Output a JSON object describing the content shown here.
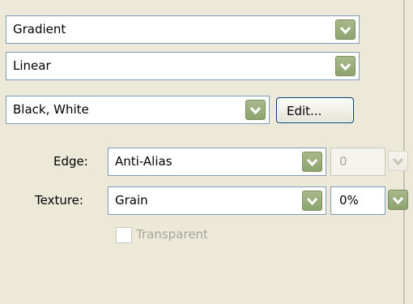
{
  "gradient_type_select": {
    "value": "Gradient"
  },
  "gradient_style_select": {
    "value": "Linear"
  },
  "color_select": {
    "value": "Black, White"
  },
  "edit_button": {
    "label": "Edit..."
  },
  "edge": {
    "label": "Edge:",
    "value": "Anti-Alias",
    "amount_value": "0"
  },
  "texture": {
    "label": "Texture:",
    "value": "Grain",
    "amount_value": "0%"
  },
  "transparent_checkbox": {
    "label": "Transparent",
    "checked": false,
    "enabled": false
  }
}
